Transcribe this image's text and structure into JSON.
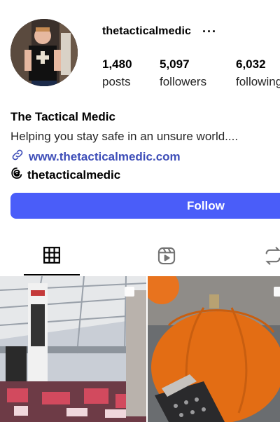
{
  "profile": {
    "username": "thetacticalmedic",
    "more_label": "···",
    "full_name": "The Tactical Medic",
    "bio": "Helping you stay safe in an unsure world....",
    "link": "www.thetacticalmedic.com",
    "threads_handle": "thetacticalmedic"
  },
  "stats": {
    "posts": {
      "value": "1,480",
      "label": "posts"
    },
    "followers": {
      "value": "5,097",
      "label": "followers"
    },
    "following": {
      "value": "6,032",
      "label": "following"
    }
  },
  "actions": {
    "follow_label": "Follow"
  },
  "colors": {
    "follow_button": "#4a5df9",
    "link": "#3e4eb8",
    "active_tab_border": "#000000"
  },
  "tabs": [
    {
      "name": "posts-grid",
      "icon": "grid-icon",
      "active": true
    },
    {
      "name": "reels",
      "icon": "reels-icon",
      "active": false
    },
    {
      "name": "tagged",
      "icon": "tagged-icon",
      "active": false
    }
  ],
  "posts": [
    {
      "icon": "carousel-icon",
      "subject": "trade show hall"
    },
    {
      "icon": "carousel-icon",
      "subject": "pumpkin"
    }
  ]
}
